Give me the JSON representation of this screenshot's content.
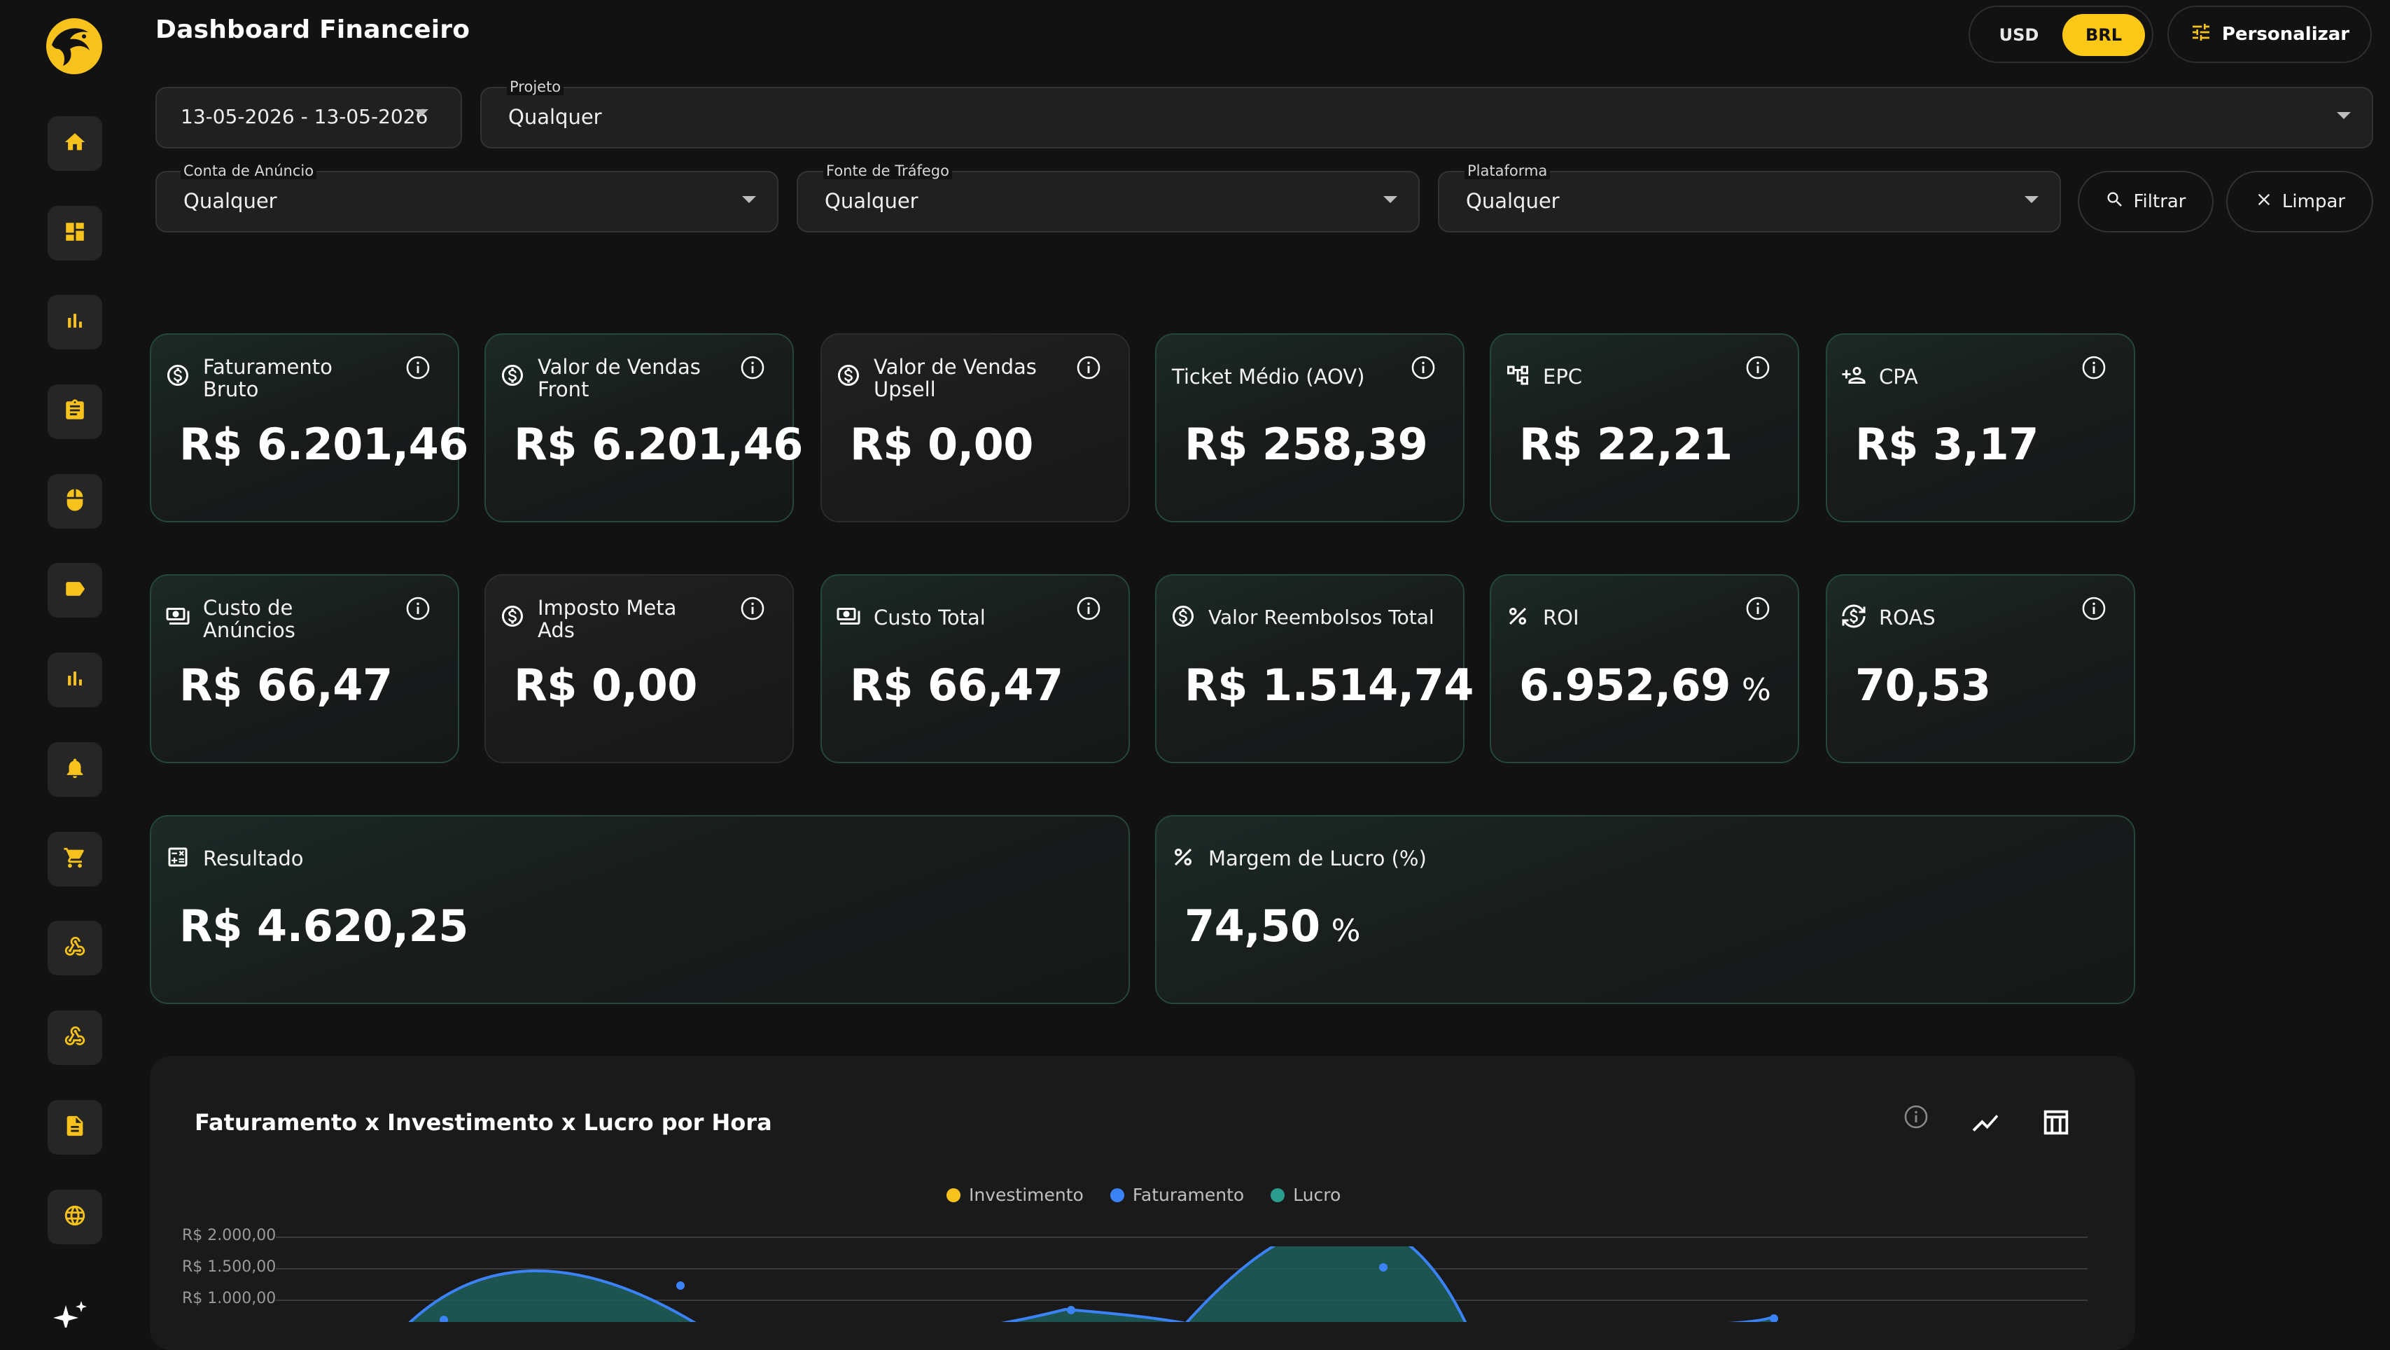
{
  "app": {
    "title": "Dashboard Financeiro"
  },
  "sidebar": {
    "items": [
      {
        "icon": "home-icon"
      },
      {
        "icon": "dashboard-icon"
      },
      {
        "icon": "bar-chart-icon"
      },
      {
        "icon": "clipboard-icon"
      },
      {
        "icon": "mouse-icon"
      },
      {
        "icon": "tag-icon"
      },
      {
        "icon": "analytics-icon"
      },
      {
        "icon": "bell-icon"
      },
      {
        "icon": "cart-icon"
      },
      {
        "icon": "webhook-icon"
      },
      {
        "icon": "webhook-icon"
      },
      {
        "icon": "document-icon"
      },
      {
        "icon": "globe-icon"
      }
    ],
    "accent": "#F7C21B"
  },
  "header": {
    "currency_usd": "USD",
    "currency_brl": "BRL",
    "currency_selected": "BRL",
    "customize_label": "Personalizar"
  },
  "filters": {
    "date_range": "13-05-2026 - 13-05-2026",
    "project": {
      "label": "Projeto",
      "value": "Qualquer"
    },
    "ad_account": {
      "label": "Conta de Anúncio",
      "value": "Qualquer"
    },
    "traffic_source": {
      "label": "Fonte de Tráfego",
      "value": "Qualquer"
    },
    "platform": {
      "label": "Plataforma",
      "value": "Qualquer"
    },
    "filter_button": "Filtrar",
    "clear_button": "Limpar"
  },
  "metrics": {
    "gross_revenue": {
      "title": "Faturamento Bruto",
      "value": "R$ 6.201,46"
    },
    "front_sales": {
      "title": "Valor de Vendas Front",
      "value": "R$ 6.201,46"
    },
    "upsell_sales": {
      "title": "Valor de Vendas Upsell",
      "value": "R$ 0,00"
    },
    "aov": {
      "title": "Ticket Médio (AOV)",
      "value": "R$ 258,39"
    },
    "epc": {
      "title": "EPC",
      "value": "R$ 22,21"
    },
    "cpa": {
      "title": "CPA",
      "value": "R$ 3,17"
    },
    "ad_cost": {
      "title": "Custo de Anúncios",
      "value": "R$ 66,47"
    },
    "meta_tax": {
      "title": "Imposto Meta Ads",
      "value": "R$ 0,00"
    },
    "total_cost": {
      "title": "Custo Total",
      "value": "R$ 66,47"
    },
    "refunds": {
      "title": "Valor Reembolsos Total",
      "value": "R$ 1.514,74"
    },
    "roi": {
      "title": "ROI",
      "value": "6.952,69",
      "unit": "%"
    },
    "roas": {
      "title": "ROAS",
      "value": "70,53"
    },
    "result": {
      "title": "Resultado",
      "value": "R$ 4.620,25"
    },
    "margin": {
      "title": "Margem de Lucro (%)",
      "value": "74,50",
      "unit": "%"
    }
  },
  "chart": {
    "title": "Faturamento x Investimento x Lucro por Hora",
    "legend": [
      {
        "name": "Investimento",
        "color": "#F7C21B"
      },
      {
        "name": "Faturamento",
        "color": "#3B82F6"
      },
      {
        "name": "Lucro",
        "color": "#2A9D8F"
      }
    ],
    "y_ticks": [
      "R$ 2.000,00",
      "R$ 1.500,00",
      "R$ 1.000,00"
    ]
  },
  "chart_data": {
    "type": "area",
    "title": "Faturamento x Investimento x Lucro por Hora",
    "y_ticks_visible": [
      2000,
      1500,
      1000
    ],
    "series": [
      {
        "name": "Faturamento",
        "peaks_visible": [
          {
            "approx": 1150
          },
          {
            "approx": 700
          },
          {
            "approx": 1930
          },
          {
            "approx": 650
          }
        ]
      },
      {
        "name": "Investimento"
      },
      {
        "name": "Lucro"
      }
    ],
    "grid": true,
    "legend_position": "top-center"
  }
}
